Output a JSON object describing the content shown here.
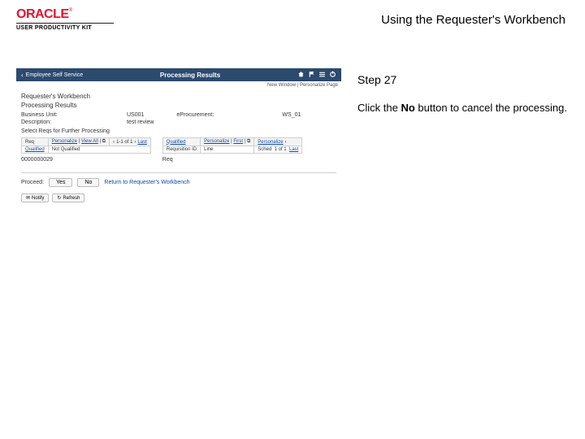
{
  "header": {
    "brand": "ORACLE",
    "tm": "®",
    "upk": "USER PRODUCTIVITY KIT",
    "title": "Using the Requester's Workbench"
  },
  "step": {
    "title": "Step 27",
    "text_prefix": "Click the ",
    "button_label": "No",
    "text_suffix": " button to cancel the processing."
  },
  "shot": {
    "bar_back": "Employee Self Service",
    "bar_title": "Processing Results",
    "sublinks": {
      "a": "New Window",
      "b": "Personalize Page"
    },
    "breadcrumb": "Requester's Workbench",
    "subheader": "Processing Results",
    "kv": [
      {
        "label": "Business Unit:",
        "value": "US001"
      },
      {
        "label": "eProcurement:",
        "value": "WS_01"
      },
      {
        "label": "Description:",
        "value": "test review"
      },
      {
        "label": "Select Reqs for Further Processing",
        "value": ""
      }
    ],
    "grid1": {
      "title_a": "Personalize",
      "title_b": "View All",
      "nav_icon": "⧉",
      "nav": "1-1 of 1",
      "nav_last": "Last",
      "headers": [
        "Req",
        "Not Qualified"
      ],
      "row": [
        "Qualified",
        ""
      ],
      "rowid": "0000000029"
    },
    "grid2": {
      "nav": "1 of 1",
      "nav_last": "Last",
      "headers": [
        "Requisition",
        "First",
        "Personalize"
      ],
      "row": [
        "Requisition ID",
        "Line",
        "Sched",
        "1 of 1",
        "Last"
      ]
    },
    "budget": "Req",
    "proceed": {
      "label": "Proceed:",
      "yes": "Yes",
      "no": "No",
      "return_link": "Return to Requester's Workbench"
    },
    "footer_btns": {
      "notify": "Notify",
      "refresh": "Refresh"
    }
  }
}
